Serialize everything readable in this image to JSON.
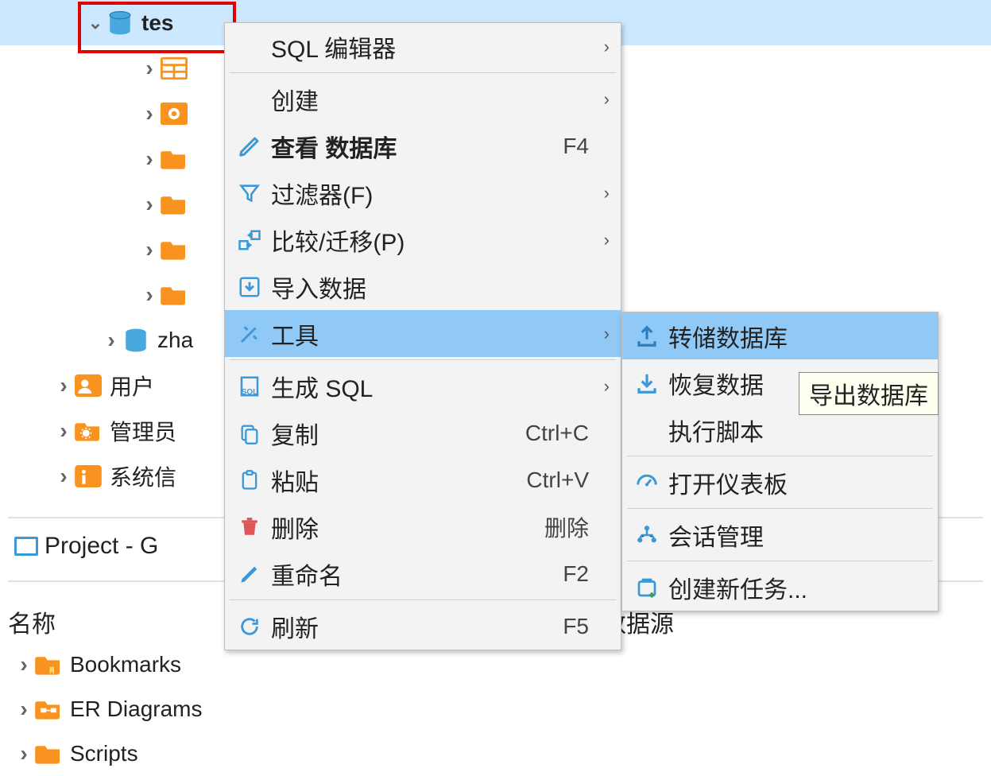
{
  "tree": {
    "selected_db": "tes",
    "zha_label": "zha",
    "users": "用户",
    "admin": "管理员",
    "sysinfo": "系统信",
    "behind_menu": "数据源"
  },
  "project": {
    "title": "Project - G",
    "name_header": "名称",
    "bookmarks": "Bookmarks",
    "er": "ER Diagrams",
    "scripts": "Scripts"
  },
  "menu": {
    "sql_editor": "SQL 编辑器",
    "create": "创建",
    "view_db": "查看 数据库",
    "view_db_key": "F4",
    "filter": "过滤器(F)",
    "compare": "比较/迁移(P)",
    "import": "导入数据",
    "tools": "工具",
    "gen_sql": "生成 SQL",
    "copy": "复制",
    "copy_key": "Ctrl+C",
    "paste": "粘贴",
    "paste_key": "Ctrl+V",
    "delete": "删除",
    "delete_key": "删除",
    "rename": "重命名",
    "rename_key": "F2",
    "refresh": "刷新",
    "refresh_key": "F5"
  },
  "submenu": {
    "dump": "转储数据库",
    "restore": "恢复数据",
    "exec_script": "执行脚本",
    "dashboard": "打开仪表板",
    "session": "会话管理",
    "new_task": "创建新任务..."
  },
  "tooltip": "导出数据库"
}
